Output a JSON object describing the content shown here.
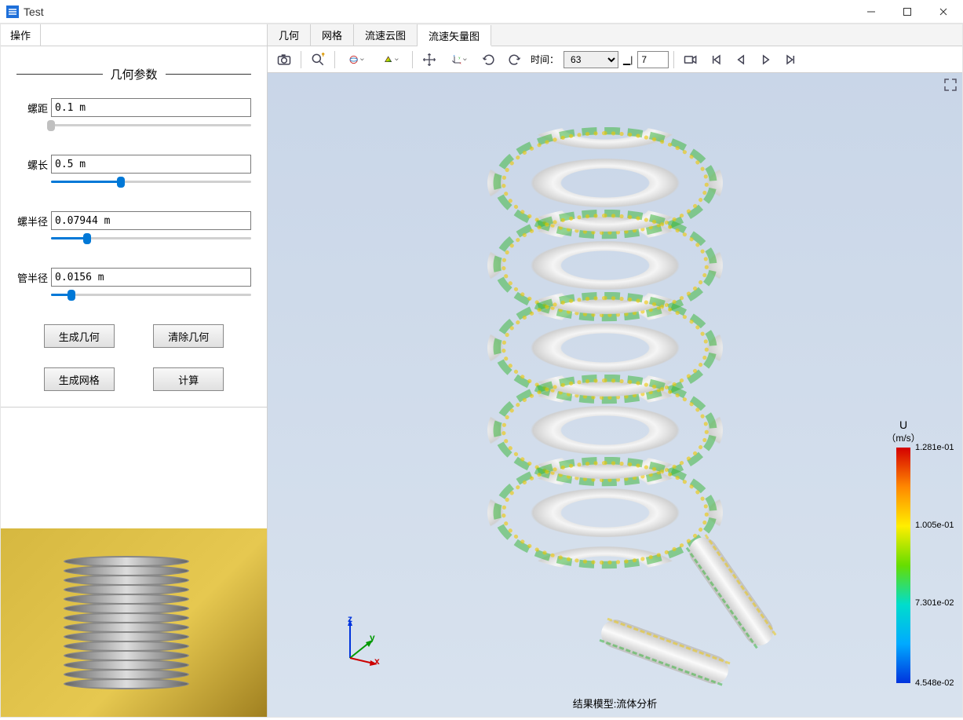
{
  "window": {
    "title": "Test"
  },
  "ops_tab": "操作",
  "section_title": "几何参数",
  "params": {
    "pitch": {
      "label": "螺距",
      "value": "0.1 m",
      "slider_pct": 0
    },
    "length": {
      "label": "螺长",
      "value": "0.5 m",
      "slider_pct": 35
    },
    "radius": {
      "label": "螺半径",
      "value": "0.07944 m",
      "slider_pct": 18
    },
    "tuberad": {
      "label": "管半径",
      "value": "0.0156 m",
      "slider_pct": 10
    }
  },
  "buttons": {
    "gen_geom": "生成几何",
    "clear_geom": "清除几何",
    "gen_mesh": "生成网格",
    "compute": "计算"
  },
  "tabs": {
    "geom": "几何",
    "mesh": "网格",
    "contour": "流速云图",
    "vector": "流速矢量图"
  },
  "toolbar": {
    "time_label": "时间：",
    "time_value": "63",
    "frame_value": "7"
  },
  "legend": {
    "title": "U",
    "unit": "（m/s）",
    "ticks": [
      "1.281e-01",
      "1.005e-01",
      "7.301e-02",
      "4.548e-02"
    ]
  },
  "triad": {
    "x": "x",
    "y": "y",
    "z": "z"
  },
  "footer": "结果模型:流体分析",
  "chart_data": {
    "type": "3d-vector-field",
    "description": "Velocity vector field (U, m/s) on helical coil pipe surface",
    "scalar": "U",
    "unit": "m/s",
    "range": [
      0.04548,
      0.1281
    ],
    "colormap_ticks": [
      0.1281,
      0.1005,
      0.07301,
      0.04548
    ],
    "geometry": {
      "pitch_m": 0.1,
      "length_m": 0.5,
      "coil_radius_m": 0.07944,
      "tube_radius_m": 0.0156,
      "turns_visible": 5
    },
    "time_step": 63
  }
}
